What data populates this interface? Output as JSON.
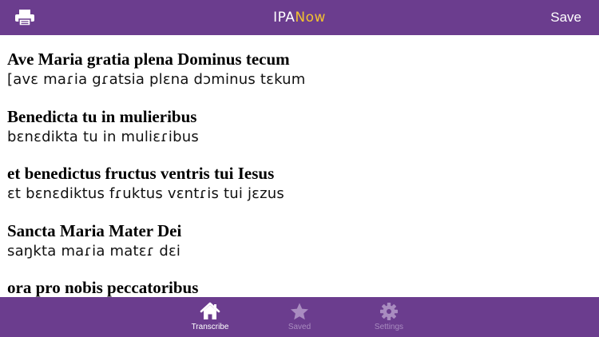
{
  "header": {
    "title_part1": "IPA",
    "title_part2": "Now",
    "save_label": "Save",
    "colors": {
      "bar": "#6b3d8e",
      "accent": "#f2c230"
    }
  },
  "transcription": {
    "lines": [
      {
        "latin": "Ave Maria gratia plena Dominus tecum",
        "ipa": "[avɛ maɾia gɾatsia plɛna dɔminus tɛkum"
      },
      {
        "latin": "Benedicta tu in mulieribus",
        "ipa": "bɛnɛdikta tu in muliɛɾibus"
      },
      {
        "latin": "et benedictus fructus ventris tui Iesus",
        "ipa": "ɛt bɛnɛdiktus fɾuktus vɛntɾis tui jɛzus"
      },
      {
        "latin": "Sancta Maria Mater Dei",
        "ipa": "saŋkta maɾia matɛɾ dɛi"
      },
      {
        "latin": "ora pro nobis peccatoribus",
        "ipa": ""
      }
    ]
  },
  "tabs": [
    {
      "label": "Transcribe",
      "icon": "home-icon",
      "active": true
    },
    {
      "label": "Saved",
      "icon": "star-icon",
      "active": false
    },
    {
      "label": "Settings",
      "icon": "gear-icon",
      "active": false
    }
  ]
}
